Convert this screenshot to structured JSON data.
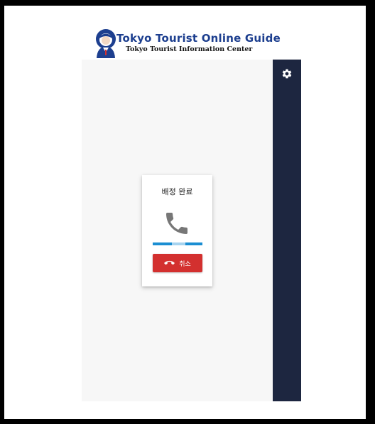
{
  "header": {
    "title": "Tokyo Tourist Online Guide",
    "subtitle": "Tokyo Tourist Information Center",
    "logo_icon": "guide-person-icon"
  },
  "sidebar": {
    "settings_icon": "gear-icon"
  },
  "call": {
    "status": "배정 완료",
    "icon": "phone-icon",
    "progress_indicator": "indeterminate",
    "cancel_label": "취소",
    "cancel_icon": "hang-up-icon"
  },
  "colors": {
    "rail": "#1d2640",
    "accent_blue": "#1b8ed2",
    "cancel_red": "#d3302f",
    "logo_blue": "#1d3f8f"
  }
}
